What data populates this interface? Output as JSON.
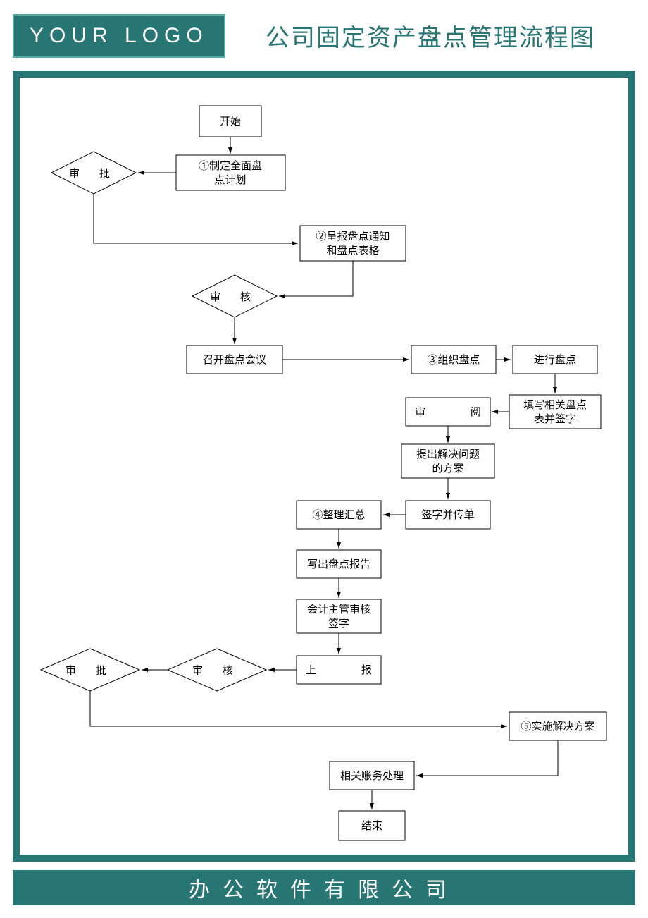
{
  "header": {
    "logo": "YOUR LOGO",
    "title": "公司固定资产盘点管理流程图"
  },
  "footer": "办公软件有限公司",
  "nodes": {
    "start": "开始",
    "plan": "①制定全面盘点计划",
    "approve1": "审 批",
    "notify": "②呈报盘点通知和盘点表格",
    "review1": "审 核",
    "meeting": "召开盘点会议",
    "organize": "③组织盘点",
    "execute": "进行盘点",
    "fillform": "填写相关盘点表并签字",
    "read": "审 阅",
    "propose": "提出解决问题的方案",
    "signpass": "签字并传单",
    "summary": "④整理汇总",
    "report": "写出盘点报告",
    "accountant": "会计主管审核签字",
    "submit": "上 报",
    "review2": "审 核",
    "approve2": "审 批",
    "implement": "⑤实施解决方案",
    "account": "相关账务处理",
    "end": "结束"
  }
}
